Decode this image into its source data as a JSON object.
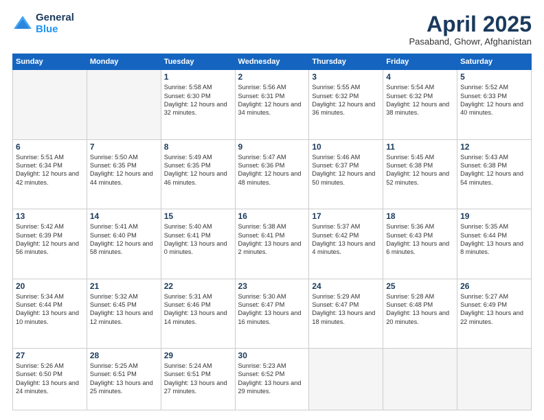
{
  "header": {
    "logo": {
      "general": "General",
      "blue": "Blue"
    },
    "title": "April 2025",
    "location": "Pasaband, Ghowr, Afghanistan"
  },
  "days_of_week": [
    "Sunday",
    "Monday",
    "Tuesday",
    "Wednesday",
    "Thursday",
    "Friday",
    "Saturday"
  ],
  "weeks": [
    [
      {
        "day": "",
        "empty": true
      },
      {
        "day": "",
        "empty": true
      },
      {
        "day": "1",
        "sunrise": "Sunrise: 5:58 AM",
        "sunset": "Sunset: 6:30 PM",
        "daylight": "Daylight: 12 hours and 32 minutes."
      },
      {
        "day": "2",
        "sunrise": "Sunrise: 5:56 AM",
        "sunset": "Sunset: 6:31 PM",
        "daylight": "Daylight: 12 hours and 34 minutes."
      },
      {
        "day": "3",
        "sunrise": "Sunrise: 5:55 AM",
        "sunset": "Sunset: 6:32 PM",
        "daylight": "Daylight: 12 hours and 36 minutes."
      },
      {
        "day": "4",
        "sunrise": "Sunrise: 5:54 AM",
        "sunset": "Sunset: 6:32 PM",
        "daylight": "Daylight: 12 hours and 38 minutes."
      },
      {
        "day": "5",
        "sunrise": "Sunrise: 5:52 AM",
        "sunset": "Sunset: 6:33 PM",
        "daylight": "Daylight: 12 hours and 40 minutes."
      }
    ],
    [
      {
        "day": "6",
        "sunrise": "Sunrise: 5:51 AM",
        "sunset": "Sunset: 6:34 PM",
        "daylight": "Daylight: 12 hours and 42 minutes."
      },
      {
        "day": "7",
        "sunrise": "Sunrise: 5:50 AM",
        "sunset": "Sunset: 6:35 PM",
        "daylight": "Daylight: 12 hours and 44 minutes."
      },
      {
        "day": "8",
        "sunrise": "Sunrise: 5:49 AM",
        "sunset": "Sunset: 6:35 PM",
        "daylight": "Daylight: 12 hours and 46 minutes."
      },
      {
        "day": "9",
        "sunrise": "Sunrise: 5:47 AM",
        "sunset": "Sunset: 6:36 PM",
        "daylight": "Daylight: 12 hours and 48 minutes."
      },
      {
        "day": "10",
        "sunrise": "Sunrise: 5:46 AM",
        "sunset": "Sunset: 6:37 PM",
        "daylight": "Daylight: 12 hours and 50 minutes."
      },
      {
        "day": "11",
        "sunrise": "Sunrise: 5:45 AM",
        "sunset": "Sunset: 6:38 PM",
        "daylight": "Daylight: 12 hours and 52 minutes."
      },
      {
        "day": "12",
        "sunrise": "Sunrise: 5:43 AM",
        "sunset": "Sunset: 6:38 PM",
        "daylight": "Daylight: 12 hours and 54 minutes."
      }
    ],
    [
      {
        "day": "13",
        "sunrise": "Sunrise: 5:42 AM",
        "sunset": "Sunset: 6:39 PM",
        "daylight": "Daylight: 12 hours and 56 minutes."
      },
      {
        "day": "14",
        "sunrise": "Sunrise: 5:41 AM",
        "sunset": "Sunset: 6:40 PM",
        "daylight": "Daylight: 12 hours and 58 minutes."
      },
      {
        "day": "15",
        "sunrise": "Sunrise: 5:40 AM",
        "sunset": "Sunset: 6:41 PM",
        "daylight": "Daylight: 13 hours and 0 minutes."
      },
      {
        "day": "16",
        "sunrise": "Sunrise: 5:38 AM",
        "sunset": "Sunset: 6:41 PM",
        "daylight": "Daylight: 13 hours and 2 minutes."
      },
      {
        "day": "17",
        "sunrise": "Sunrise: 5:37 AM",
        "sunset": "Sunset: 6:42 PM",
        "daylight": "Daylight: 13 hours and 4 minutes."
      },
      {
        "day": "18",
        "sunrise": "Sunrise: 5:36 AM",
        "sunset": "Sunset: 6:43 PM",
        "daylight": "Daylight: 13 hours and 6 minutes."
      },
      {
        "day": "19",
        "sunrise": "Sunrise: 5:35 AM",
        "sunset": "Sunset: 6:44 PM",
        "daylight": "Daylight: 13 hours and 8 minutes."
      }
    ],
    [
      {
        "day": "20",
        "sunrise": "Sunrise: 5:34 AM",
        "sunset": "Sunset: 6:44 PM",
        "daylight": "Daylight: 13 hours and 10 minutes."
      },
      {
        "day": "21",
        "sunrise": "Sunrise: 5:32 AM",
        "sunset": "Sunset: 6:45 PM",
        "daylight": "Daylight: 13 hours and 12 minutes."
      },
      {
        "day": "22",
        "sunrise": "Sunrise: 5:31 AM",
        "sunset": "Sunset: 6:46 PM",
        "daylight": "Daylight: 13 hours and 14 minutes."
      },
      {
        "day": "23",
        "sunrise": "Sunrise: 5:30 AM",
        "sunset": "Sunset: 6:47 PM",
        "daylight": "Daylight: 13 hours and 16 minutes."
      },
      {
        "day": "24",
        "sunrise": "Sunrise: 5:29 AM",
        "sunset": "Sunset: 6:47 PM",
        "daylight": "Daylight: 13 hours and 18 minutes."
      },
      {
        "day": "25",
        "sunrise": "Sunrise: 5:28 AM",
        "sunset": "Sunset: 6:48 PM",
        "daylight": "Daylight: 13 hours and 20 minutes."
      },
      {
        "day": "26",
        "sunrise": "Sunrise: 5:27 AM",
        "sunset": "Sunset: 6:49 PM",
        "daylight": "Daylight: 13 hours and 22 minutes."
      }
    ],
    [
      {
        "day": "27",
        "sunrise": "Sunrise: 5:26 AM",
        "sunset": "Sunset: 6:50 PM",
        "daylight": "Daylight: 13 hours and 24 minutes."
      },
      {
        "day": "28",
        "sunrise": "Sunrise: 5:25 AM",
        "sunset": "Sunset: 6:51 PM",
        "daylight": "Daylight: 13 hours and 25 minutes."
      },
      {
        "day": "29",
        "sunrise": "Sunrise: 5:24 AM",
        "sunset": "Sunset: 6:51 PM",
        "daylight": "Daylight: 13 hours and 27 minutes."
      },
      {
        "day": "30",
        "sunrise": "Sunrise: 5:23 AM",
        "sunset": "Sunset: 6:52 PM",
        "daylight": "Daylight: 13 hours and 29 minutes."
      },
      {
        "day": "",
        "empty": true
      },
      {
        "day": "",
        "empty": true
      },
      {
        "day": "",
        "empty": true
      }
    ]
  ]
}
